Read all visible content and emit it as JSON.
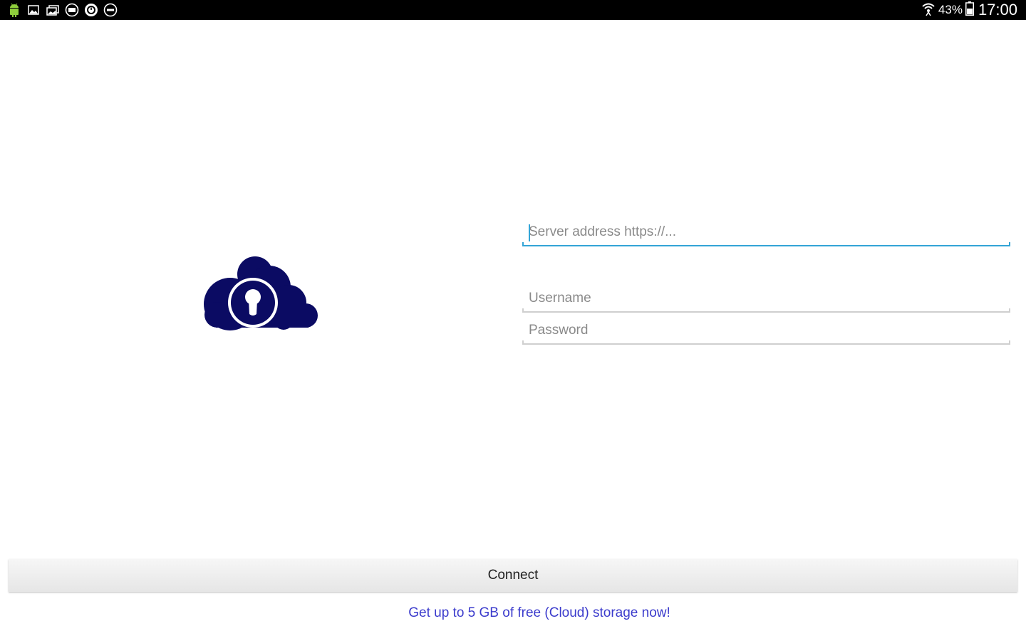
{
  "status_bar": {
    "left_icons": [
      "android-icon",
      "image-icon",
      "gallery-icon",
      "hd-icon",
      "timer-icon",
      "minus-circle-icon"
    ],
    "battery_percent": "43%",
    "time": "17:00"
  },
  "logo": {
    "icon": "cloud-lock-icon",
    "color": "#0b0b63"
  },
  "form": {
    "server": {
      "placeholder": "Server address https://...",
      "value": ""
    },
    "username": {
      "placeholder": "Username",
      "value": ""
    },
    "password": {
      "placeholder": "Password",
      "value": ""
    },
    "connect_label": "Connect"
  },
  "promo": {
    "link_text": "Get up to 5 GB of free (Cloud) storage now!",
    "color": "#3b3bcc"
  },
  "colors": {
    "accent": "#33a4d6",
    "status_bar_bg": "#000000"
  }
}
